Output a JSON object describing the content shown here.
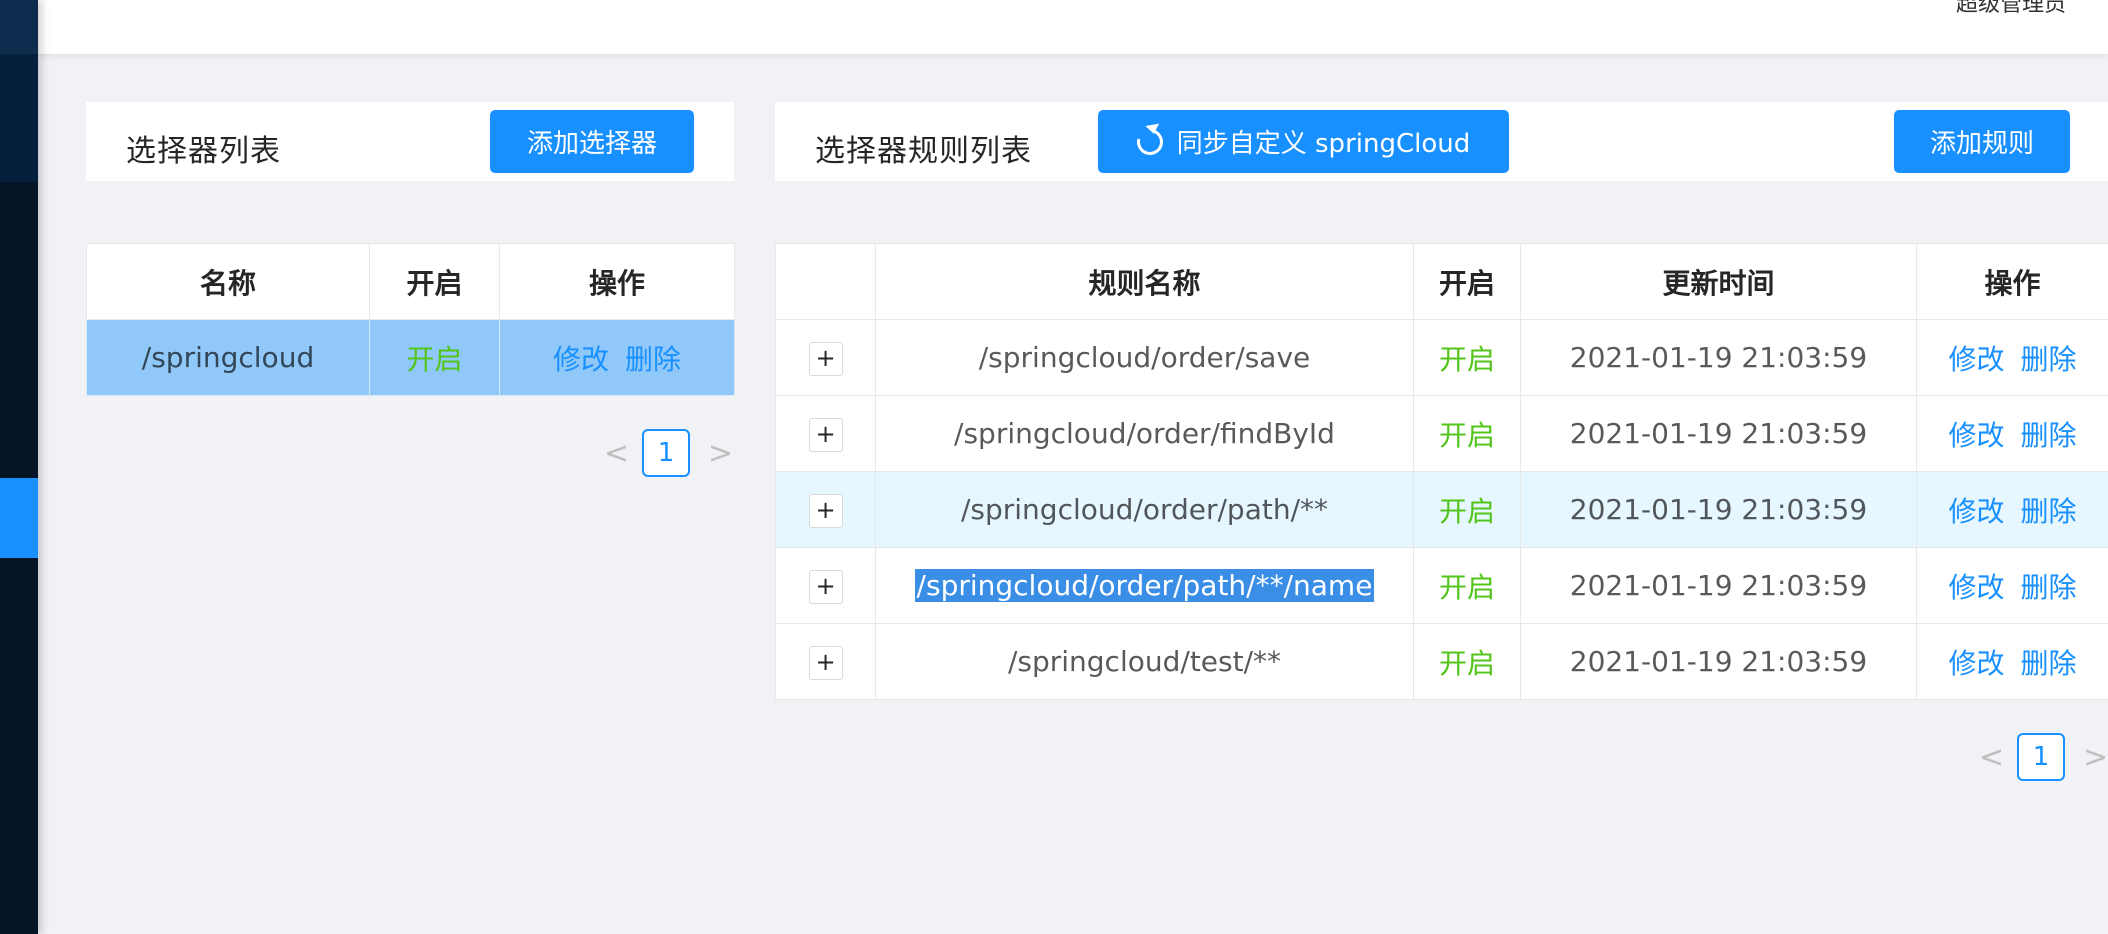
{
  "header": {
    "user_text": "超级管理员"
  },
  "selector_panel": {
    "title": "选择器列表",
    "add_button": "添加选择器",
    "columns": [
      "名称",
      "开启",
      "操作"
    ],
    "rows": [
      {
        "name": "/springcloud",
        "status": "开启",
        "edit": "修改",
        "delete": "删除"
      }
    ],
    "pagination": {
      "prev": "<",
      "page": "1",
      "next": ">"
    }
  },
  "rule_panel": {
    "title": "选择器规则列表",
    "sync_button": "同步自定义 springCloud",
    "add_button": "添加规则",
    "columns": [
      "",
      "规则名称",
      "开启",
      "更新时间",
      "操作"
    ],
    "rows": [
      {
        "expand": "+",
        "name": "/springcloud/order/save",
        "status": "开启",
        "time": "2021-01-19 21:03:59",
        "edit": "修改",
        "delete": "删除"
      },
      {
        "expand": "+",
        "name": "/springcloud/order/findById",
        "status": "开启",
        "time": "2021-01-19 21:03:59",
        "edit": "修改",
        "delete": "删除"
      },
      {
        "expand": "+",
        "name": "/springcloud/order/path/**",
        "status": "开启",
        "time": "2021-01-19 21:03:59",
        "edit": "修改",
        "delete": "删除"
      },
      {
        "expand": "+",
        "name": "/springcloud/order/path/**/name",
        "status": "开启",
        "time": "2021-01-19 21:03:59",
        "edit": "修改",
        "delete": "删除"
      },
      {
        "expand": "+",
        "name": "/springcloud/test/**",
        "status": "开启",
        "time": "2021-01-19 21:03:59",
        "edit": "修改",
        "delete": "删除"
      }
    ],
    "pagination": {
      "prev": "<",
      "page": "1",
      "next": ">"
    }
  },
  "colors": {
    "primary": "#1890ff",
    "enabled": "#52c41a",
    "sidebar": "#031526"
  }
}
